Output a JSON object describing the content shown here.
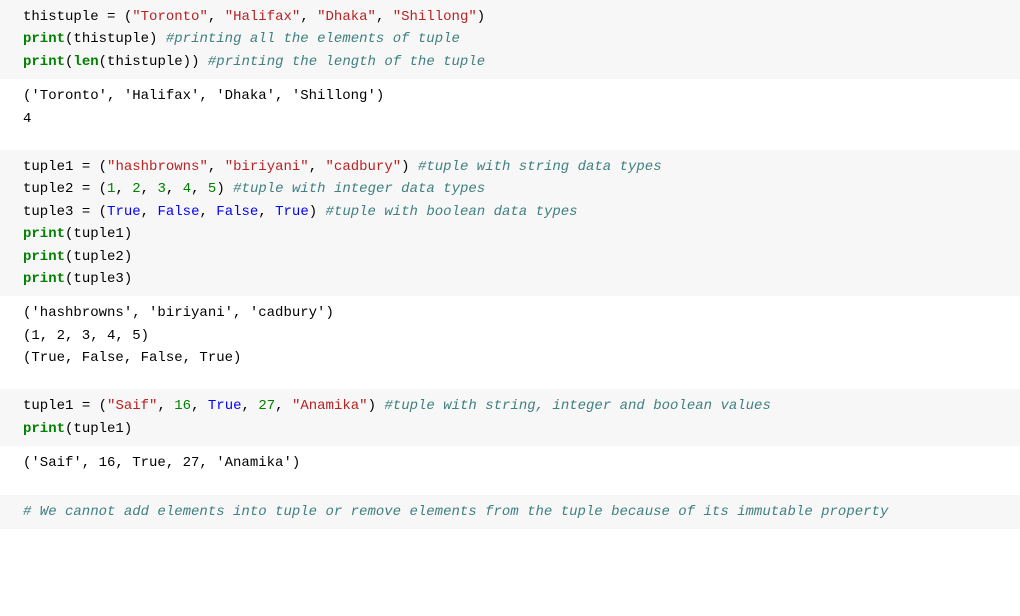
{
  "cells": {
    "c1": {
      "line1": {
        "var": "thistuple",
        "eq": " = ",
        "lparen": "(",
        "s1": "\"Toronto\"",
        "comma1": ", ",
        "s2": "\"Halifax\"",
        "comma2": ", ",
        "s3": "\"Dhaka\"",
        "comma3": ", ",
        "s4": "\"Shillong\"",
        "rparen": ")"
      },
      "line2": {
        "print": "print",
        "lparen": "(",
        "arg": "thistuple",
        "rparen": ") ",
        "comment": "#printing all the elements of tuple"
      },
      "line3": {
        "print": "print",
        "lparen": "(",
        "len": "len",
        "lparen2": "(",
        "arg": "thistuple",
        "rparen2": ")",
        "rparen": ") ",
        "comment": "#printing the length of the tuple"
      },
      "output": "('Toronto', 'Halifax', 'Dhaka', 'Shillong')\n4"
    },
    "c2": {
      "line1": {
        "var": "tuple1",
        "eq": " = ",
        "lparen": "(",
        "s1": "\"hashbrowns\"",
        "comma1": ", ",
        "s2": "\"biriyani\"",
        "comma2": ", ",
        "s3": "\"cadbury\"",
        "rparen": ") ",
        "comment": "#tuple with string data types"
      },
      "line2": {
        "var": "tuple2",
        "eq": " = ",
        "lparen": "(",
        "n1": "1",
        "c1": ", ",
        "n2": "2",
        "c2": ", ",
        "n3": "3",
        "c3": ", ",
        "n4": "4",
        "c4": ", ",
        "n5": "5",
        "rparen": ") ",
        "comment": "#tuple with integer data types"
      },
      "line3": {
        "var": "tuple3",
        "eq": " = ",
        "lparen": "(",
        "b1": "True",
        "c1": ", ",
        "b2": "False",
        "c2": ", ",
        "b3": "False",
        "c3": ", ",
        "b4": "True",
        "rparen": ") ",
        "comment": "#tuple with boolean data types"
      },
      "line4": {
        "print": "print",
        "lparen": "(",
        "arg": "tuple1",
        "rparen": ")"
      },
      "line5": {
        "print": "print",
        "lparen": "(",
        "arg": "tuple2",
        "rparen": ")"
      },
      "line6": {
        "print": "print",
        "lparen": "(",
        "arg": "tuple3",
        "rparen": ")"
      },
      "output": "('hashbrowns', 'biriyani', 'cadbury')\n(1, 2, 3, 4, 5)\n(True, False, False, True)"
    },
    "c3": {
      "line1": {
        "var": "tuple1",
        "eq": " = ",
        "lparen": "(",
        "s1": "\"Saif\"",
        "c1": ", ",
        "n1": "16",
        "c2": ", ",
        "b1": "True",
        "c3": ", ",
        "n2": "27",
        "c4": ", ",
        "s2": "\"Anamika\"",
        "rparen": ") ",
        "comment": "#tuple with string, integer and boolean values"
      },
      "line2": {
        "print": "print",
        "lparen": "(",
        "arg": "tuple1",
        "rparen": ")"
      },
      "output": "('Saif', 16, True, 27, 'Anamika')"
    },
    "c4": {
      "line1": {
        "comment": "# We cannot add elements into tuple or remove elements from the tuple because of its immutable property"
      }
    }
  }
}
